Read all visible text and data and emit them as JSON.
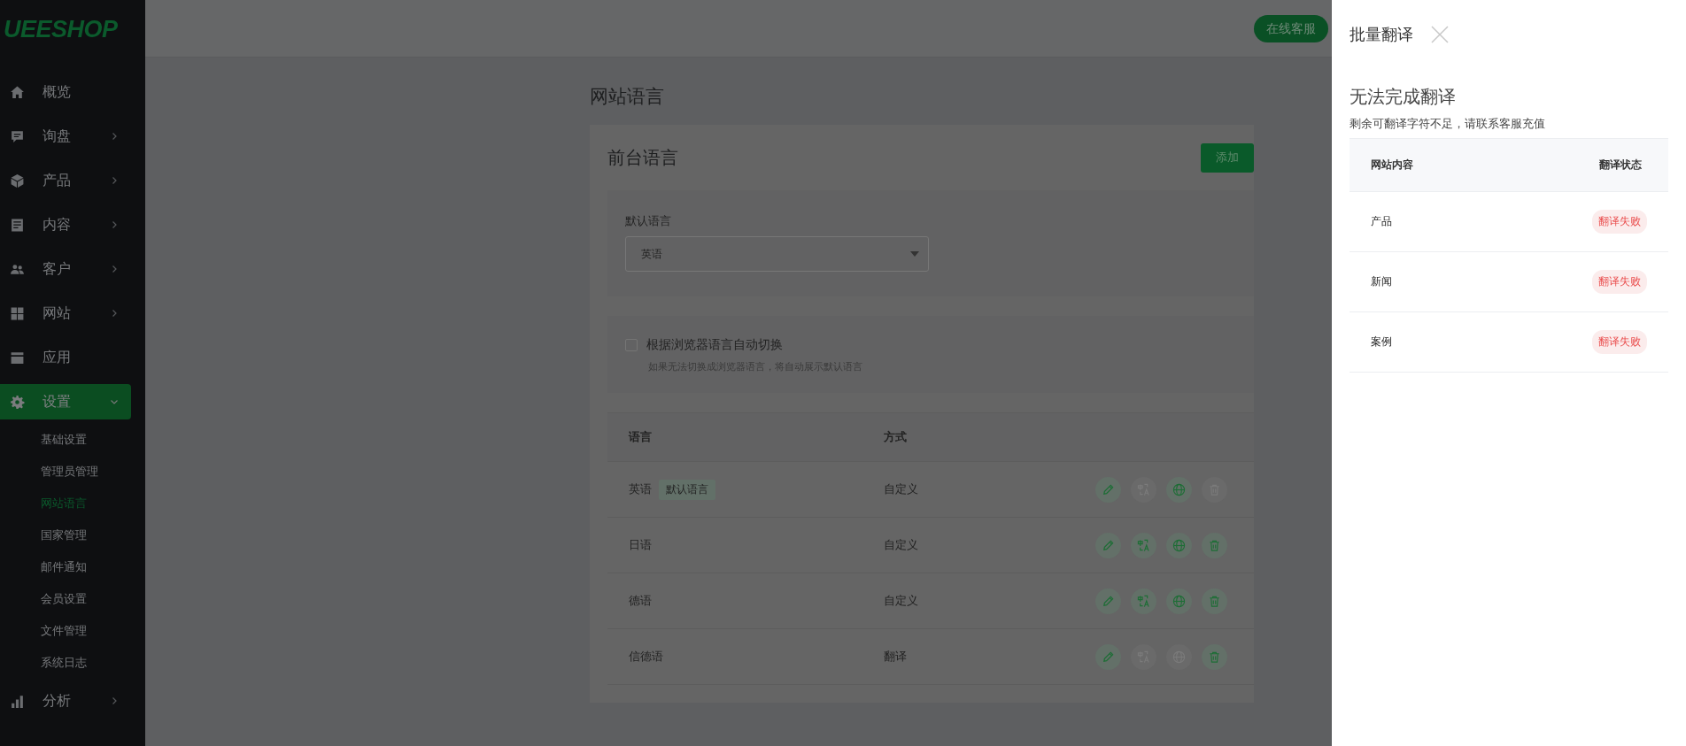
{
  "brand": {
    "logo": "UEESHOP"
  },
  "sidebar": {
    "items": [
      {
        "label": "概览",
        "has_children": false,
        "selected": false
      },
      {
        "label": "询盘",
        "has_children": true,
        "expanded": false,
        "selected": false
      },
      {
        "label": "产品",
        "has_children": true,
        "expanded": false,
        "selected": false
      },
      {
        "label": "内容",
        "has_children": true,
        "expanded": false,
        "selected": false
      },
      {
        "label": "客户",
        "has_children": true,
        "expanded": false,
        "selected": false
      },
      {
        "label": "网站",
        "has_children": true,
        "expanded": false,
        "selected": false
      },
      {
        "label": "应用",
        "has_children": false,
        "selected": false
      },
      {
        "label": "设置",
        "has_children": true,
        "expanded": true,
        "selected": true,
        "children": [
          {
            "label": "基础设置",
            "selected": false
          },
          {
            "label": "管理员管理",
            "selected": false
          },
          {
            "label": "网站语言",
            "selected": true
          },
          {
            "label": "国家管理",
            "selected": false
          },
          {
            "label": "邮件通知",
            "selected": false
          },
          {
            "label": "会员设置",
            "selected": false
          },
          {
            "label": "文件管理",
            "selected": false
          },
          {
            "label": "系统日志",
            "selected": false
          }
        ]
      },
      {
        "label": "分析",
        "has_children": true,
        "expanded": false,
        "selected": false
      }
    ]
  },
  "top_bar": {
    "support_button": "在线客服"
  },
  "page_title": "网站语言",
  "card": {
    "title": "前台语言",
    "add_button": "添加",
    "default_language": {
      "label": "默认语言",
      "value": "英语"
    },
    "auto_switch": {
      "checked": false,
      "label": "根据浏览器语言自动切换",
      "hint": "如果无法切换成浏览器语言，将自动展示默认语言"
    },
    "table": {
      "columns": [
        "语言",
        "方式"
      ],
      "rows": [
        {
          "language": "英语",
          "tag": "默认语言",
          "method": "自定义",
          "actions": [
            {
              "kind": "edit",
              "disabled": false
            },
            {
              "kind": "translate",
              "disabled": true
            },
            {
              "kind": "globe",
              "disabled": false
            },
            {
              "kind": "delete",
              "disabled": true
            }
          ]
        },
        {
          "language": "日语",
          "method": "自定义",
          "actions": [
            {
              "kind": "edit",
              "disabled": false
            },
            {
              "kind": "translate",
              "disabled": false
            },
            {
              "kind": "globe",
              "disabled": false
            },
            {
              "kind": "delete",
              "disabled": false
            }
          ]
        },
        {
          "language": "德语",
          "method": "自定义",
          "actions": [
            {
              "kind": "edit",
              "disabled": false
            },
            {
              "kind": "translate",
              "disabled": false
            },
            {
              "kind": "globe",
              "disabled": false
            },
            {
              "kind": "delete",
              "disabled": false
            }
          ]
        },
        {
          "language": "信德语",
          "method": "翻译",
          "actions": [
            {
              "kind": "edit",
              "disabled": false
            },
            {
              "kind": "translate",
              "disabled": true
            },
            {
              "kind": "globe",
              "disabled": true
            },
            {
              "kind": "delete",
              "disabled": false
            }
          ]
        }
      ]
    }
  },
  "drawer": {
    "title": "批量翻译",
    "heading": "无法完成翻译",
    "message": "剩余可翻译字符不足，请联系客服充值",
    "table": {
      "columns": [
        "网站内容",
        "翻译状态"
      ],
      "rows": [
        {
          "content": "产品",
          "status": "翻译失败",
          "kind": "failed"
        },
        {
          "content": "新闻",
          "status": "翻译失败",
          "kind": "failed"
        },
        {
          "content": "案例",
          "status": "翻译失败",
          "kind": "failed"
        }
      ]
    }
  }
}
